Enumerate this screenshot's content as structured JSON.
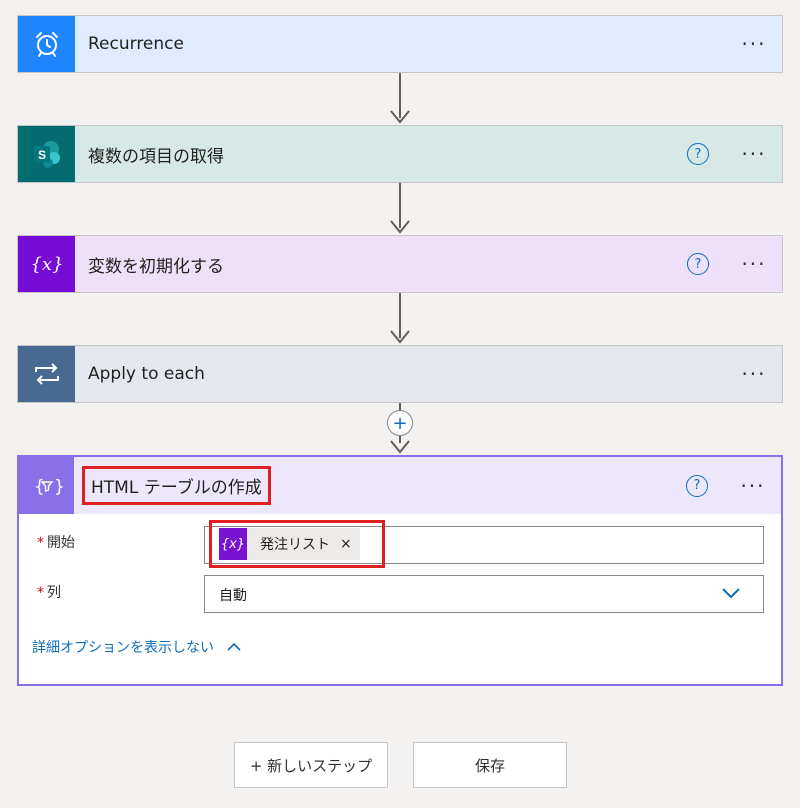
{
  "steps": [
    {
      "title": "Recurrence",
      "icon": "alarm-clock-icon",
      "bg": "#deecfd",
      "icon_bg": "#1f85ff",
      "help": false
    },
    {
      "title": "複数の項目の取得",
      "icon": "sharepoint-icon",
      "bg": "#d7e9e7",
      "icon_bg": "#036c70",
      "help": true
    },
    {
      "title": "変数を初期化する",
      "icon": "variable-icon",
      "bg": "#ede0f8",
      "icon_bg": "#770bd6",
      "help": true
    },
    {
      "title": "Apply to each",
      "icon": "loop-icon",
      "bg": "#e4e8ee",
      "icon_bg": "#486991",
      "help": false
    }
  ],
  "help_glyph": "?",
  "more_glyph": "···",
  "add_glyph": "+",
  "action": {
    "title": "HTML テーブルの作成",
    "icon": "data-operation-icon",
    "accent": "#8a70e8",
    "fields": {
      "from_label": "開始",
      "from_token": "発注リスト",
      "from_token_icon": "{x}",
      "token_remove": "×",
      "columns_label": "列",
      "columns_value": "自動"
    },
    "required_mark": "*",
    "advanced_link": "詳細オプションを表示しない"
  },
  "buttons": {
    "new_step": "+ 新しいステップ",
    "save": "保存"
  }
}
